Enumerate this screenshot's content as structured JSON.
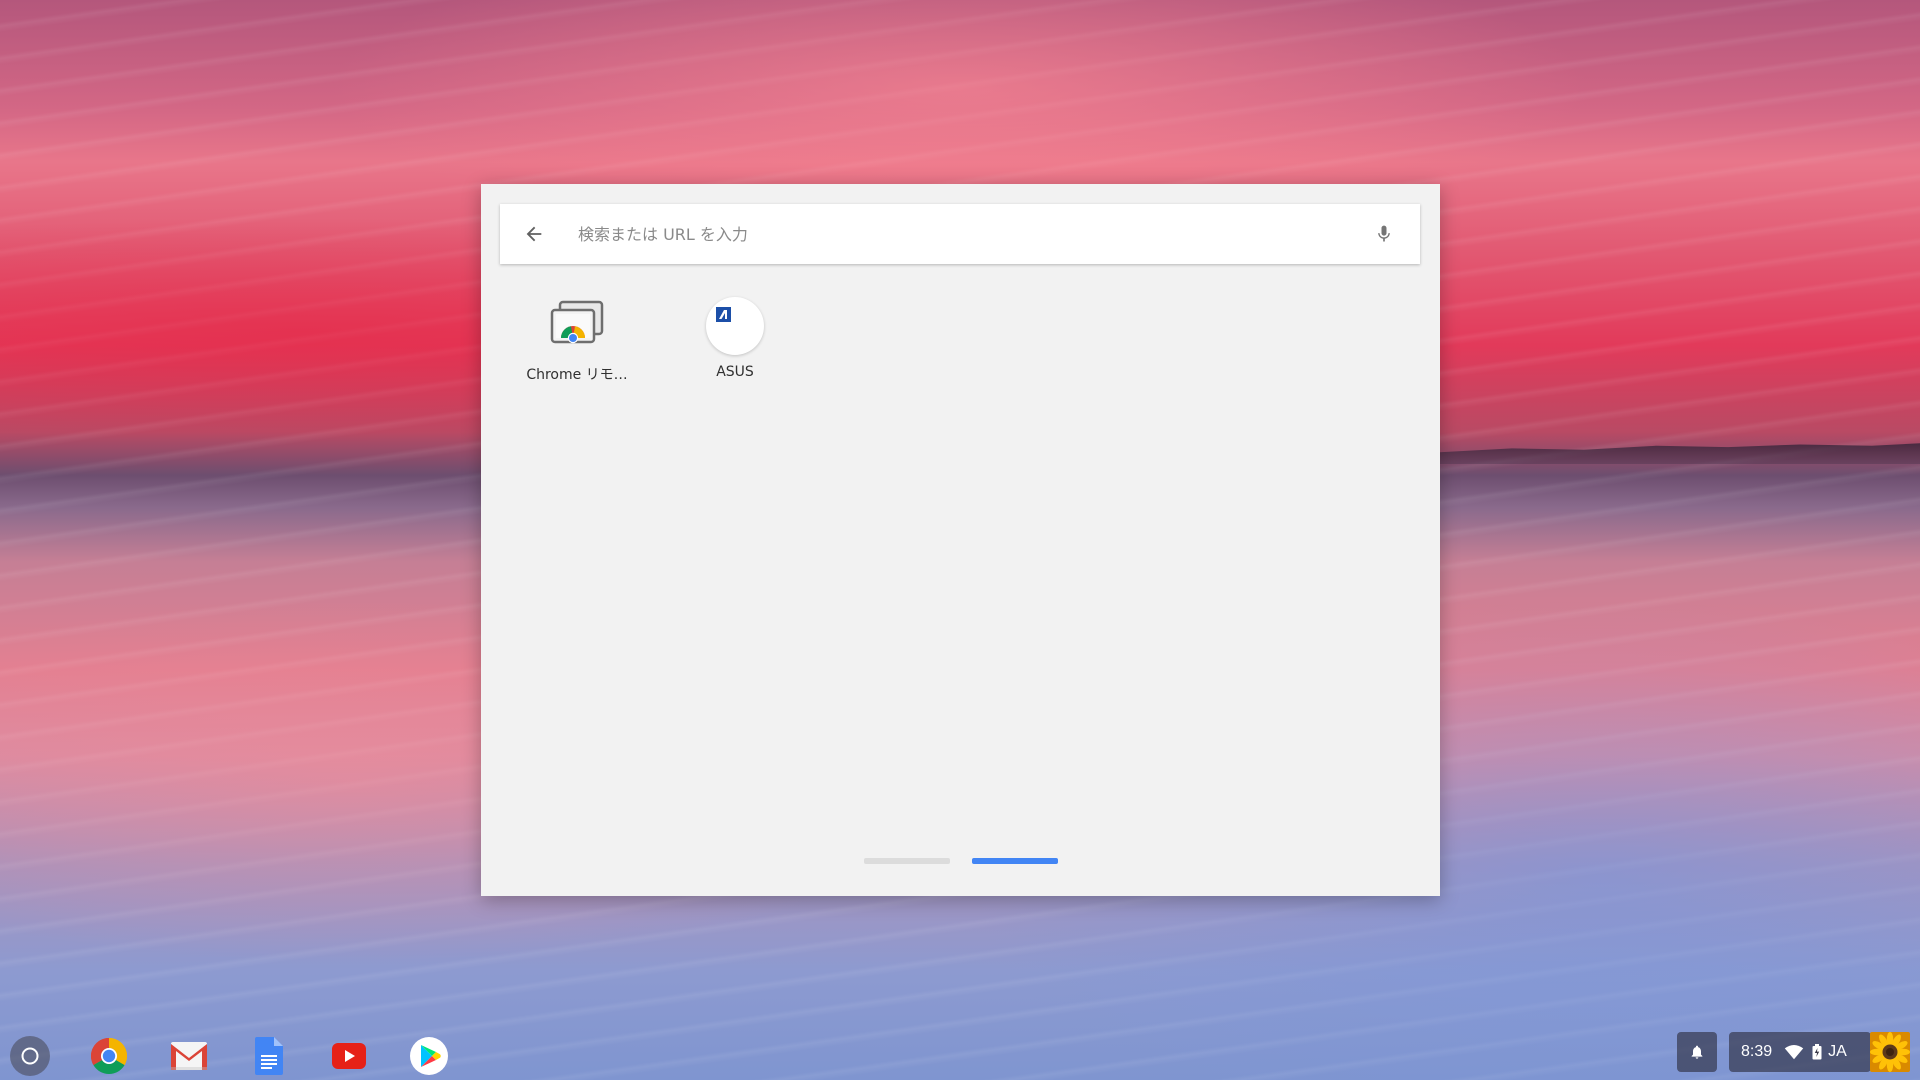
{
  "launcher": {
    "search": {
      "placeholder": "検索または URL を入力",
      "value": ""
    },
    "apps": [
      {
        "label": "Chrome リモ…",
        "icon": "chrome-remote-desktop-icon"
      },
      {
        "label": "ASUS",
        "icon": "asus-icon"
      }
    ],
    "pages": {
      "count": 2,
      "active": 2
    }
  },
  "shelf": {
    "pinned_apps": [
      {
        "name": "Chrome",
        "icon": "chrome-icon"
      },
      {
        "name": "Gmail",
        "icon": "gmail-icon"
      },
      {
        "name": "Google ドキュメント",
        "icon": "docs-icon"
      },
      {
        "name": "YouTube",
        "icon": "youtube-icon"
      },
      {
        "name": "Play ストア",
        "icon": "play-store-icon"
      }
    ]
  },
  "status": {
    "time": "8:39",
    "ime": "JA"
  },
  "colors": {
    "accent": "#4285f4",
    "launcher_bg": "#f2f2f2",
    "tray_bg": "#282837"
  }
}
